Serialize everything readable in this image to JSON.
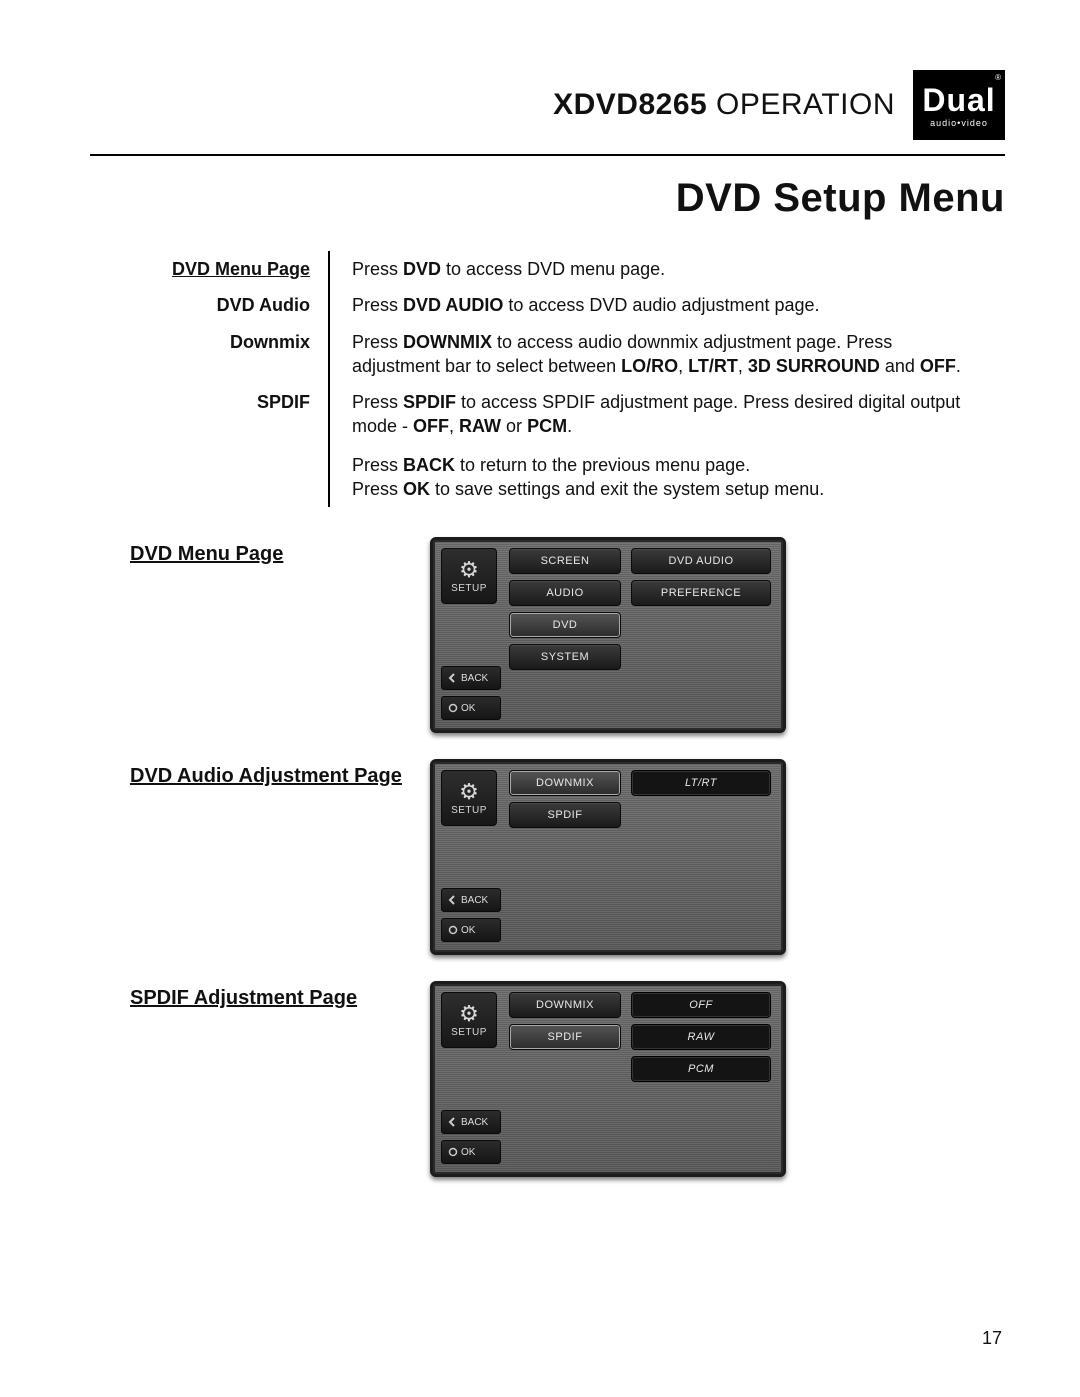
{
  "header": {
    "model": "XDVD8265",
    "word": "OPERATION",
    "logo_main": "Dual",
    "logo_reg": "®",
    "logo_sub": "audio•video"
  },
  "section_title": "DVD Setup Menu",
  "defs": [
    {
      "label": "DVD Menu Page",
      "underline": true,
      "body_html": "Press <b>DVD</b> to access DVD menu page."
    },
    {
      "label": "DVD Audio",
      "body_html": "Press <b>DVD AUDIO</b> to access DVD audio adjustment page."
    },
    {
      "label": "Downmix",
      "body_html": "Press <b>DOWNMIX</b> to access audio downmix adjustment page. Press adjustment bar to select between <b>LO/RO</b>, <b>LT/RT</b>, <b>3D SURROUND</b> and <b>OFF</b>."
    },
    {
      "label": "SPDIF",
      "body_html": "Press <b>SPDIF</b> to access SPDIF adjustment page. Press desired digital output mode - <b>OFF</b>, <b>RAW</b> or <b>PCM</b>.<span class='gap'></span>Press <b>BACK</b> to return to the previous menu page.<br>Press <b>OK</b> to save settings and exit the system setup menu."
    }
  ],
  "ui_common": {
    "setup_label": "SETUP",
    "back_label": "BACK",
    "ok_label": "OK"
  },
  "shots": {
    "dvd_menu": {
      "caption": "DVD Menu Page",
      "col1": [
        "SCREEN",
        "AUDIO",
        "DVD",
        "SYSTEM"
      ],
      "col1_selected_index": 2,
      "col2": [
        "DVD AUDIO",
        "PREFERENCE"
      ]
    },
    "dvd_audio": {
      "caption": "DVD Audio Adjustment Page",
      "col1": [
        "DOWNMIX",
        "SPDIF"
      ],
      "col1_selected_index": 0,
      "col2_values": [
        "LT/RT"
      ]
    },
    "spdif": {
      "caption": "SPDIF Adjustment Page",
      "col1": [
        "DOWNMIX",
        "SPDIF"
      ],
      "col1_selected_index": 1,
      "col2_values": [
        "OFF",
        "RAW",
        "PCM"
      ]
    }
  },
  "page_number": "17"
}
